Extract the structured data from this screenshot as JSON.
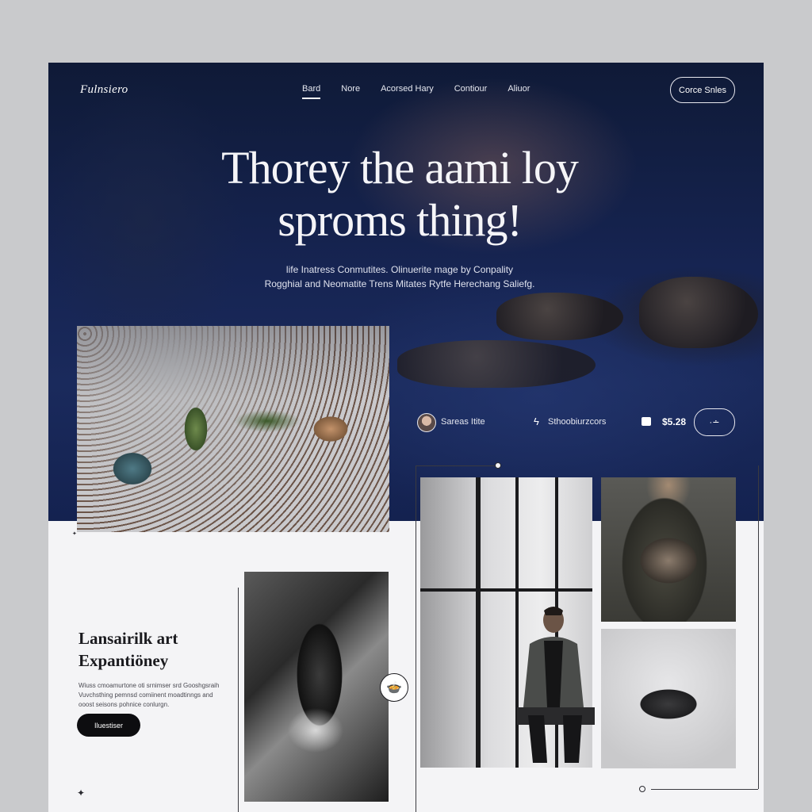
{
  "brand": {
    "logo_text": "Fulnsiero"
  },
  "nav": {
    "links": [
      {
        "label": "Bard",
        "active": true
      },
      {
        "label": "Nore",
        "active": false
      },
      {
        "label": "Acorsed Hary",
        "active": false
      },
      {
        "label": "Contiour",
        "active": false
      },
      {
        "label": "Aliuor",
        "active": false
      }
    ],
    "cta_label": "Corce Snles"
  },
  "hero": {
    "headline_line1": "Thorey the aami loy",
    "headline_line2": "sproms thing!",
    "subtext_line1": "life Inatress Conmutites. Olinuerite mage by Conpality",
    "subtext_line2": "Rogghial and Neomatite Trens Mitates Rytfe Herechang Saliefg."
  },
  "meta": {
    "author": "Sareas Itite",
    "category": "Sthoobiurzcors",
    "price": "$5.28",
    "button_label": "·∸"
  },
  "feature": {
    "title_line1": "Lansairilk art",
    "title_line2": "Expantiöney",
    "body": "Wiuss cmoamurtone oti srnimser srd Gooshgsraih Vuvchsthing pemnsd comiinent moadtinngs and ooost seisons pohnice conlurgn.",
    "button_label": "Iluestiser"
  },
  "badge_icon": "🍲",
  "colors": {
    "hero_bg": "#162452",
    "page_bg": "#f4f4f6",
    "button_dark": "#0d0d10"
  }
}
